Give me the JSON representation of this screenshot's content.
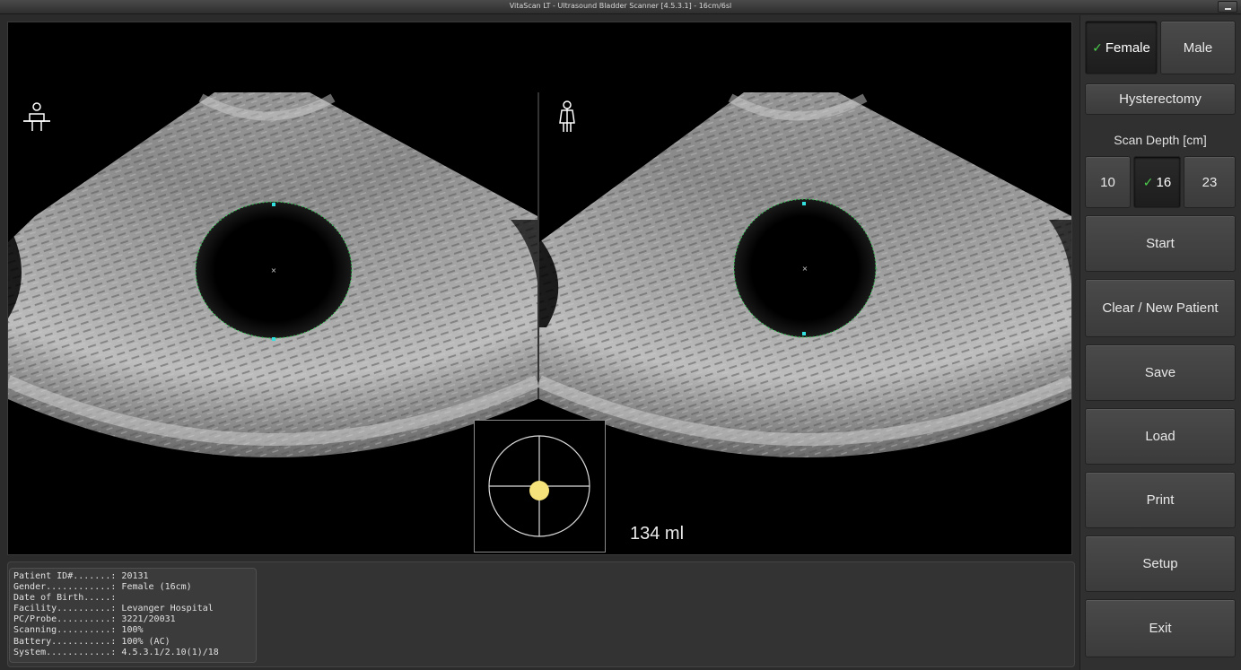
{
  "window": {
    "title": "VitaScan LT - Ultrasound Bladder Scanner [4.5.3.1] - 16cm/6sl"
  },
  "scan": {
    "volume": "134 ml"
  },
  "sidebar": {
    "female_label": "Female",
    "male_label": "Male",
    "hysterectomy_label": "Hysterectomy",
    "depth_label": "Scan Depth [cm]",
    "depth_options": [
      "10",
      "16",
      "23"
    ],
    "selected_gender": "Female",
    "selected_depth": "16",
    "start_label": "Start",
    "clear_label": "Clear / New Patient",
    "save_label": "Save",
    "load_label": "Load",
    "print_label": "Print",
    "setup_label": "Setup",
    "exit_label": "Exit"
  },
  "patient_info": [
    {
      "label": "Patient ID#.......:",
      "value": "20131"
    },
    {
      "label": "Gender............:",
      "value": "Female (16cm)"
    },
    {
      "label": "Date of Birth.....:",
      "value": ""
    },
    {
      "label": "Facility..........:",
      "value": "Levanger Hospital"
    },
    {
      "label": "PC/Probe..........:",
      "value": "3221/20031"
    },
    {
      "label": "Scanning..........:",
      "value": "100%"
    },
    {
      "label": "Battery...........:",
      "value": "100% (AC)"
    },
    {
      "label": "System............:",
      "value": "4.5.3.1/2.10(1)/18"
    }
  ],
  "colors": {
    "check": "#4cd04c",
    "outline": "#33cc55",
    "marker": "#33e0e0",
    "target": "#f5e27a"
  }
}
